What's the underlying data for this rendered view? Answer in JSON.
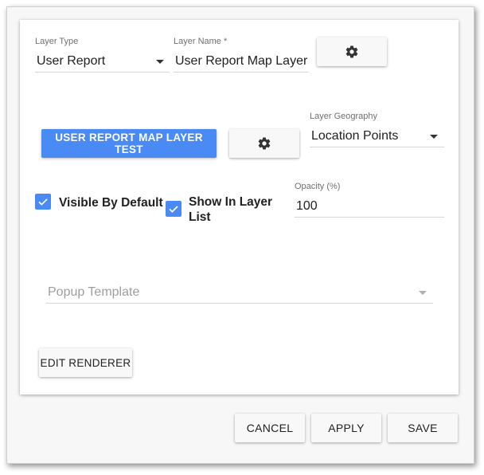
{
  "layer_type": {
    "label": "Layer Type",
    "value": "User Report"
  },
  "layer_name": {
    "label": "Layer Name *",
    "value": "User Report Map Layer"
  },
  "test_button": {
    "label": "USER REPORT MAP LAYER TEST"
  },
  "layer_geography": {
    "label": "Layer Geography",
    "value": "Location Points"
  },
  "visible_by_default": {
    "label": "Visible By Default",
    "checked": true
  },
  "show_in_layer_list": {
    "label": "Show In Layer List",
    "checked": true
  },
  "opacity": {
    "label": "Opacity (%)",
    "value": "100"
  },
  "popup_template": {
    "placeholder": "Popup Template",
    "value": ""
  },
  "edit_renderer": {
    "label": "EDIT RENDERER"
  },
  "footer": {
    "cancel": "CANCEL",
    "apply": "APPLY",
    "save": "SAVE"
  },
  "colors": {
    "accent": "#4a8af4",
    "checkbox": "#4a8af4"
  },
  "icons": {
    "settings": "gear-icon",
    "dropdown": "chevron-down-icon",
    "check": "checkmark-icon"
  }
}
